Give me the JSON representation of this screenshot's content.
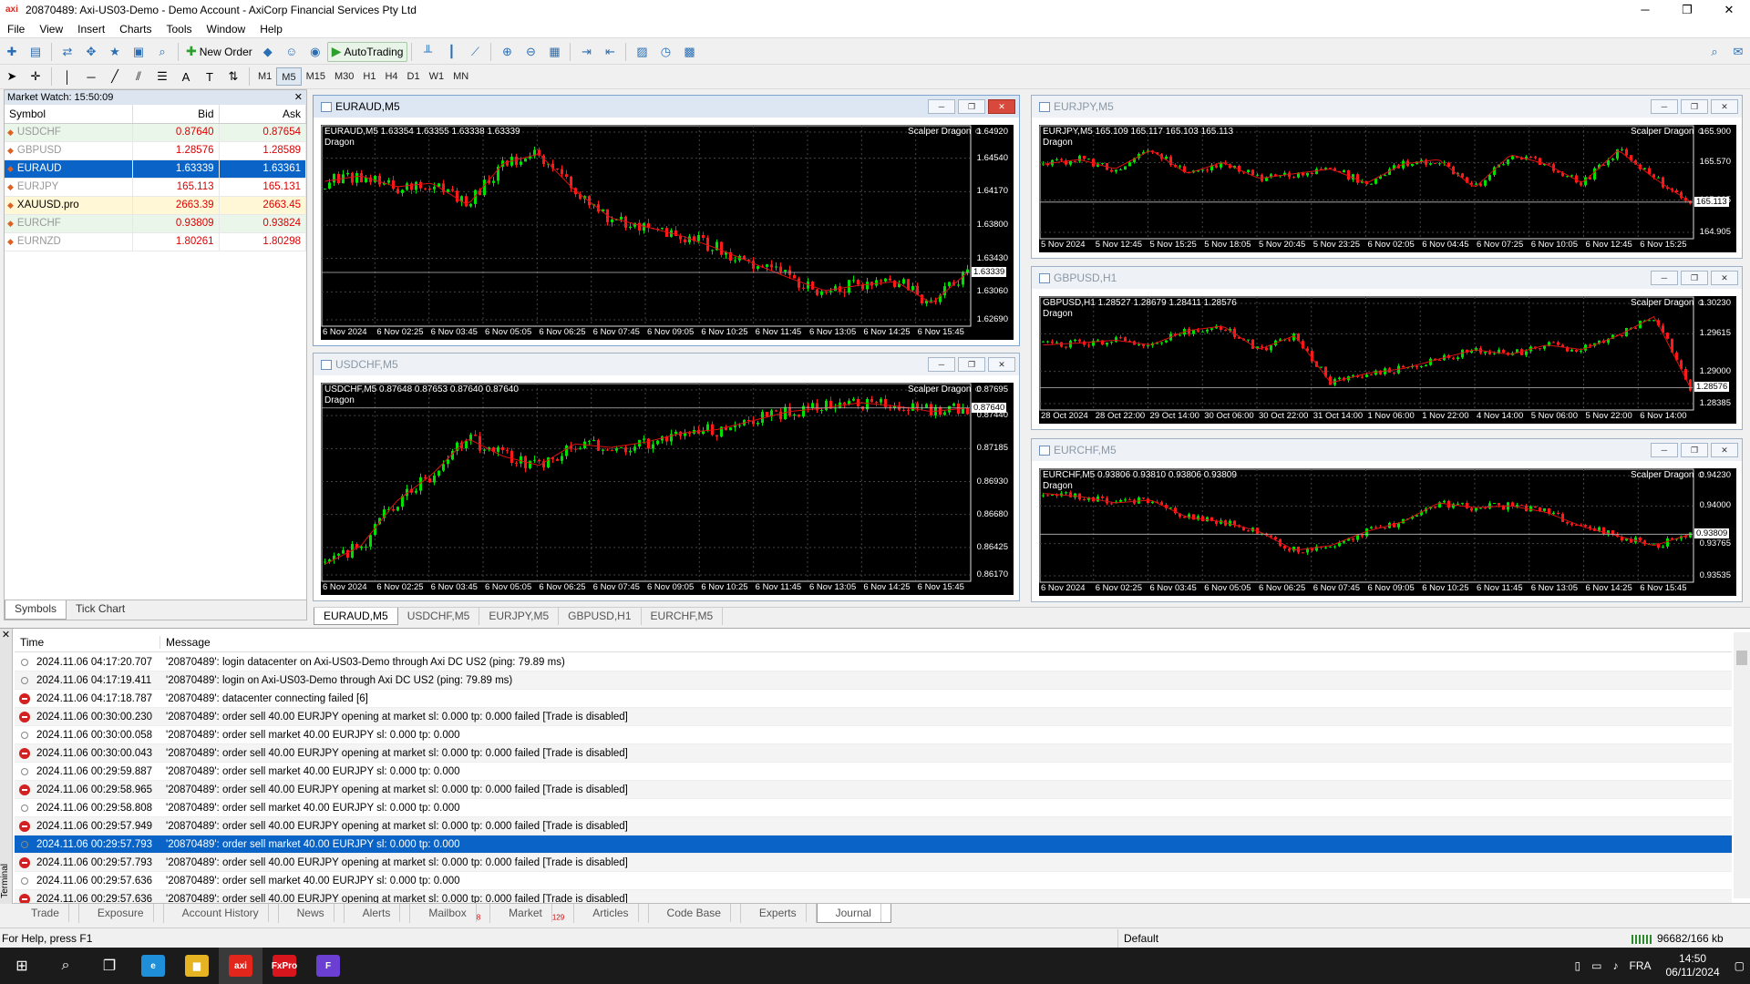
{
  "window": {
    "title": "20870489: Axi-US03-Demo - Demo Account - AxiCorp Financial Services Pty Ltd",
    "logo": "axi",
    "minimize": "─",
    "restore": "❐",
    "close": "✕"
  },
  "menu": [
    "File",
    "View",
    "Insert",
    "Charts",
    "Tools",
    "Window",
    "Help"
  ],
  "toolbar": {
    "new_order": "New Order",
    "autotrading": "AutoTrading",
    "timeframes": [
      "M1",
      "M5",
      "M15",
      "M30",
      "H1",
      "H4",
      "D1",
      "W1",
      "MN"
    ],
    "active_timeframe": "M5"
  },
  "market_watch": {
    "header": "Market Watch: 15:50:09",
    "close": "✕",
    "columns": {
      "symbol": "Symbol",
      "bid": "Bid",
      "ask": "Ask"
    },
    "rows": [
      {
        "symbol": "USDCHF",
        "bid": "0.87640",
        "ask": "0.87654"
      },
      {
        "symbol": "GBPUSD",
        "bid": "1.28576",
        "ask": "1.28589"
      },
      {
        "symbol": "EURAUD",
        "bid": "1.63339",
        "ask": "1.63361"
      },
      {
        "symbol": "EURJPY",
        "bid": "165.113",
        "ask": "165.131"
      },
      {
        "symbol": "XAUUSD.pro",
        "bid": "2663.39",
        "ask": "2663.45"
      },
      {
        "symbol": "EURCHF",
        "bid": "0.93809",
        "ask": "0.93824"
      },
      {
        "symbol": "EURNZD",
        "bid": "1.80261",
        "ask": "1.80298"
      }
    ],
    "tabs": [
      "Symbols",
      "Tick Chart"
    ]
  },
  "charts": [
    {
      "id": "euraud",
      "title": "EURAUD,M5",
      "info": "EURAUD,M5  1.63354 1.63355 1.63338 1.63339",
      "indicator": "Scalper Dragon",
      "indicator2": "Dragon",
      "price_ticks": [
        "1.64920",
        "1.64540",
        "1.64170",
        "1.63800",
        "1.63430",
        "1.63060",
        "1.62690"
      ],
      "current": "1.63339",
      "time_ticks": [
        "6 Nov 2024",
        "6 Nov 02:25",
        "6 Nov 03:45",
        "6 Nov 05:05",
        "6 Nov 06:25",
        "6 Nov 07:45",
        "6 Nov 09:05",
        "6 Nov 10:25",
        "6 Nov 11:45",
        "6 Nov 13:05",
        "6 Nov 14:25",
        "6 Nov 15:45"
      ]
    },
    {
      "id": "usdchf",
      "title": "USDCHF,M5",
      "info": "USDCHF,M5  0.87648 0.87653 0.87640 0.87640",
      "indicator": "Scalper Dragon",
      "indicator2": "Dragon",
      "price_ticks": [
        "0.87695",
        "0.87440",
        "0.87185",
        "0.86930",
        "0.86680",
        "0.86425",
        "0.86170"
      ],
      "current": "0.87640",
      "time_ticks": [
        "6 Nov 2024",
        "6 Nov 02:25",
        "6 Nov 03:45",
        "6 Nov 05:05",
        "6 Nov 06:25",
        "6 Nov 07:45",
        "6 Nov 09:05",
        "6 Nov 10:25",
        "6 Nov 11:45",
        "6 Nov 13:05",
        "6 Nov 14:25",
        "6 Nov 15:45"
      ]
    },
    {
      "id": "eurjpy",
      "title": "EURJPY,M5",
      "info": "EURJPY,M5  165.109 165.117 165.103 165.113",
      "indicator": "Scalper Dragon",
      "indicator2": "Dragon",
      "price_ticks": [
        "165.900",
        "165.570",
        "165.235",
        "164.905"
      ],
      "current": "165.113",
      "time_ticks": [
        "5 Nov 2024",
        "5 Nov 12:45",
        "5 Nov 15:25",
        "5 Nov 18:05",
        "5 Nov 20:45",
        "5 Nov 23:25",
        "6 Nov 02:05",
        "6 Nov 04:45",
        "6 Nov 07:25",
        "6 Nov 10:05",
        "6 Nov 12:45",
        "6 Nov 15:25"
      ]
    },
    {
      "id": "gbpusd",
      "title": "GBPUSD,H1",
      "info": "GBPUSD,H1  1.28527 1.28679 1.28411 1.28576",
      "indicator": "Scalper Dragon",
      "indicator2": "Dragon",
      "price_ticks": [
        "1.30230",
        "1.29615",
        "1.29000",
        "1.28385"
      ],
      "current": "1.28576",
      "time_ticks": [
        "28 Oct 2024",
        "28 Oct 22:00",
        "29 Oct 14:00",
        "30 Oct 06:00",
        "30 Oct 22:00",
        "31 Oct 14:00",
        "1 Nov 06:00",
        "1 Nov 22:00",
        "4 Nov 14:00",
        "5 Nov 06:00",
        "5 Nov 22:00",
        "6 Nov 14:00"
      ]
    },
    {
      "id": "eurchf",
      "title": "EURCHF,M5",
      "info": "EURCHF,M5  0.93806 0.93810 0.93806 0.93809",
      "indicator": "Scalper Dragon",
      "indicator2": "Dragon",
      "price_ticks": [
        "0.94230",
        "0.94000",
        "0.93765",
        "0.93535"
      ],
      "current": "0.93809",
      "time_ticks": [
        "6 Nov 2024",
        "6 Nov 02:25",
        "6 Nov 03:45",
        "6 Nov 05:05",
        "6 Nov 06:25",
        "6 Nov 07:45",
        "6 Nov 09:05",
        "6 Nov 10:25",
        "6 Nov 11:45",
        "6 Nov 13:05",
        "6 Nov 14:25",
        "6 Nov 15:45"
      ]
    }
  ],
  "chart_tabs": [
    "EURAUD,M5",
    "USDCHF,M5",
    "EURJPY,M5",
    "GBPUSD,H1",
    "EURCHF,M5"
  ],
  "terminal": {
    "side_label": "Terminal",
    "close": "✕",
    "columns": {
      "time": "Time",
      "message": "Message"
    },
    "rows": [
      {
        "type": "info",
        "time": "2024.11.06 04:17:20.707",
        "msg": "'20870489': login datacenter on Axi-US03-Demo through Axi DC US2 (ping: 79.89 ms)"
      },
      {
        "type": "info",
        "time": "2024.11.06 04:17:19.411",
        "msg": "'20870489': login on Axi-US03-Demo through Axi DC US2 (ping: 79.89 ms)"
      },
      {
        "type": "err",
        "time": "2024.11.06 04:17:18.787",
        "msg": "'20870489': datacenter connecting failed [6]"
      },
      {
        "type": "err",
        "time": "2024.11.06 00:30:00.230",
        "msg": "'20870489': order sell 40.00 EURJPY opening at market sl: 0.000 tp: 0.000 failed [Trade is disabled]"
      },
      {
        "type": "info",
        "time": "2024.11.06 00:30:00.058",
        "msg": "'20870489': order sell market 40.00 EURJPY sl: 0.000 tp: 0.000"
      },
      {
        "type": "err",
        "time": "2024.11.06 00:30:00.043",
        "msg": "'20870489': order sell 40.00 EURJPY opening at market sl: 0.000 tp: 0.000 failed [Trade is disabled]"
      },
      {
        "type": "info",
        "time": "2024.11.06 00:29:59.887",
        "msg": "'20870489': order sell market 40.00 EURJPY sl: 0.000 tp: 0.000"
      },
      {
        "type": "err",
        "time": "2024.11.06 00:29:58.965",
        "msg": "'20870489': order sell 40.00 EURJPY opening at market sl: 0.000 tp: 0.000 failed [Trade is disabled]"
      },
      {
        "type": "info",
        "time": "2024.11.06 00:29:58.808",
        "msg": "'20870489': order sell market 40.00 EURJPY sl: 0.000 tp: 0.000"
      },
      {
        "type": "err",
        "time": "2024.11.06 00:29:57.949",
        "msg": "'20870489': order sell 40.00 EURJPY opening at market sl: 0.000 tp: 0.000 failed [Trade is disabled]"
      },
      {
        "type": "info",
        "time": "2024.11.06 00:29:57.793",
        "msg": "'20870489': order sell market 40.00 EURJPY sl: 0.000 tp: 0.000",
        "selected": true
      },
      {
        "type": "err",
        "time": "2024.11.06 00:29:57.793",
        "msg": "'20870489': order sell 40.00 EURJPY opening at market sl: 0.000 tp: 0.000 failed [Trade is disabled]"
      },
      {
        "type": "info",
        "time": "2024.11.06 00:29:57.636",
        "msg": "'20870489': order sell market 40.00 EURJPY sl: 0.000 tp: 0.000"
      },
      {
        "type": "err",
        "time": "2024.11.06 00:29:57.636",
        "msg": "'20870489': order sell 40.00 EURJPY opening at market sl: 0.000 tp: 0.000 failed [Trade is disabled]"
      }
    ],
    "tabs": [
      {
        "label": "Trade"
      },
      {
        "label": "Exposure"
      },
      {
        "label": "Account History"
      },
      {
        "label": "News"
      },
      {
        "label": "Alerts"
      },
      {
        "label": "Mailbox",
        "badge": "8"
      },
      {
        "label": "Market",
        "badge": "129"
      },
      {
        "label": "Articles"
      },
      {
        "label": "Code Base"
      },
      {
        "label": "Experts"
      },
      {
        "label": "Journal",
        "active": true
      }
    ]
  },
  "status": {
    "help": "For Help, press F1",
    "profile": "Default",
    "kb": "96682/166 kb"
  },
  "taskbar": {
    "lang": "FRA",
    "time": "14:50",
    "date": "06/11/2024",
    "apps": [
      {
        "name": "edge",
        "label": "e",
        "color": "#1e8fd8"
      },
      {
        "name": "explorer",
        "label": "▆",
        "color": "#e6b422"
      },
      {
        "name": "axi",
        "label": "axi",
        "color": "#e2261c"
      },
      {
        "name": "fxpro",
        "label": "FxPro",
        "color": "#d8141c"
      },
      {
        "name": "app-f",
        "label": "F",
        "color": "#6b3fd1"
      }
    ]
  }
}
